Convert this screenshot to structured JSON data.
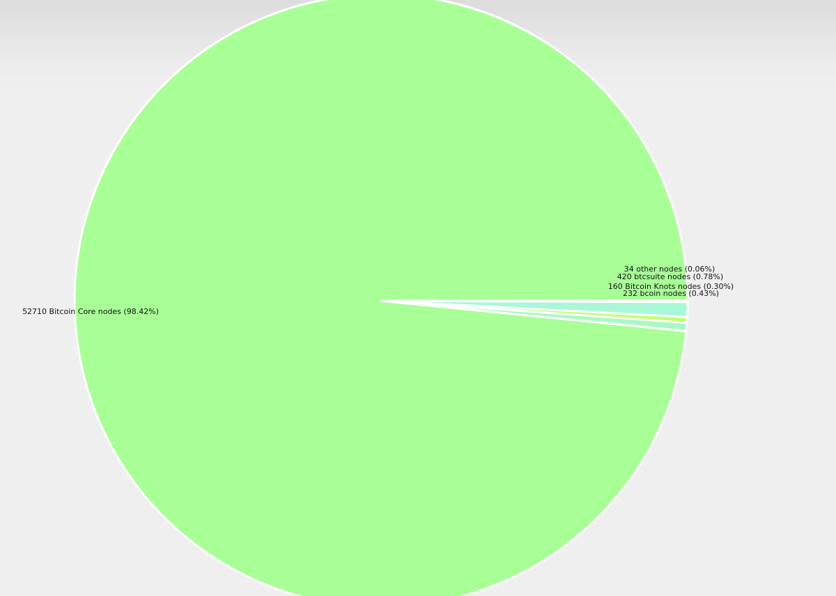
{
  "chart_data": {
    "type": "pie",
    "title": "",
    "slices": [
      {
        "label": "52710 Bitcoin Core nodes (98.42%)",
        "name": "Bitcoin Core",
        "value": 52710,
        "percent": 98.42,
        "color": "#a8ff96"
      },
      {
        "label": "232 bcoin nodes (0.43%)",
        "name": "bcoin",
        "value": 232,
        "percent": 0.43,
        "color": "#a8f8c4"
      },
      {
        "label": "160 Bitcoin Knots nodes (0.30%)",
        "name": "Bitcoin Knots",
        "value": 160,
        "percent": 0.3,
        "color": "#c0ff70"
      },
      {
        "label": "420 btcsuite nodes (0.78%)",
        "name": "btcsuite",
        "value": 420,
        "percent": 0.78,
        "color": "#a8f8d8"
      },
      {
        "label": "34 other nodes (0.06%)",
        "name": "other",
        "value": 34,
        "percent": 0.06,
        "color": "#b8ff88"
      }
    ],
    "start_angle": "east (3 o'clock)",
    "direction": "counterclockwise",
    "legend": "none",
    "slice_border_color": "#ffffff"
  }
}
